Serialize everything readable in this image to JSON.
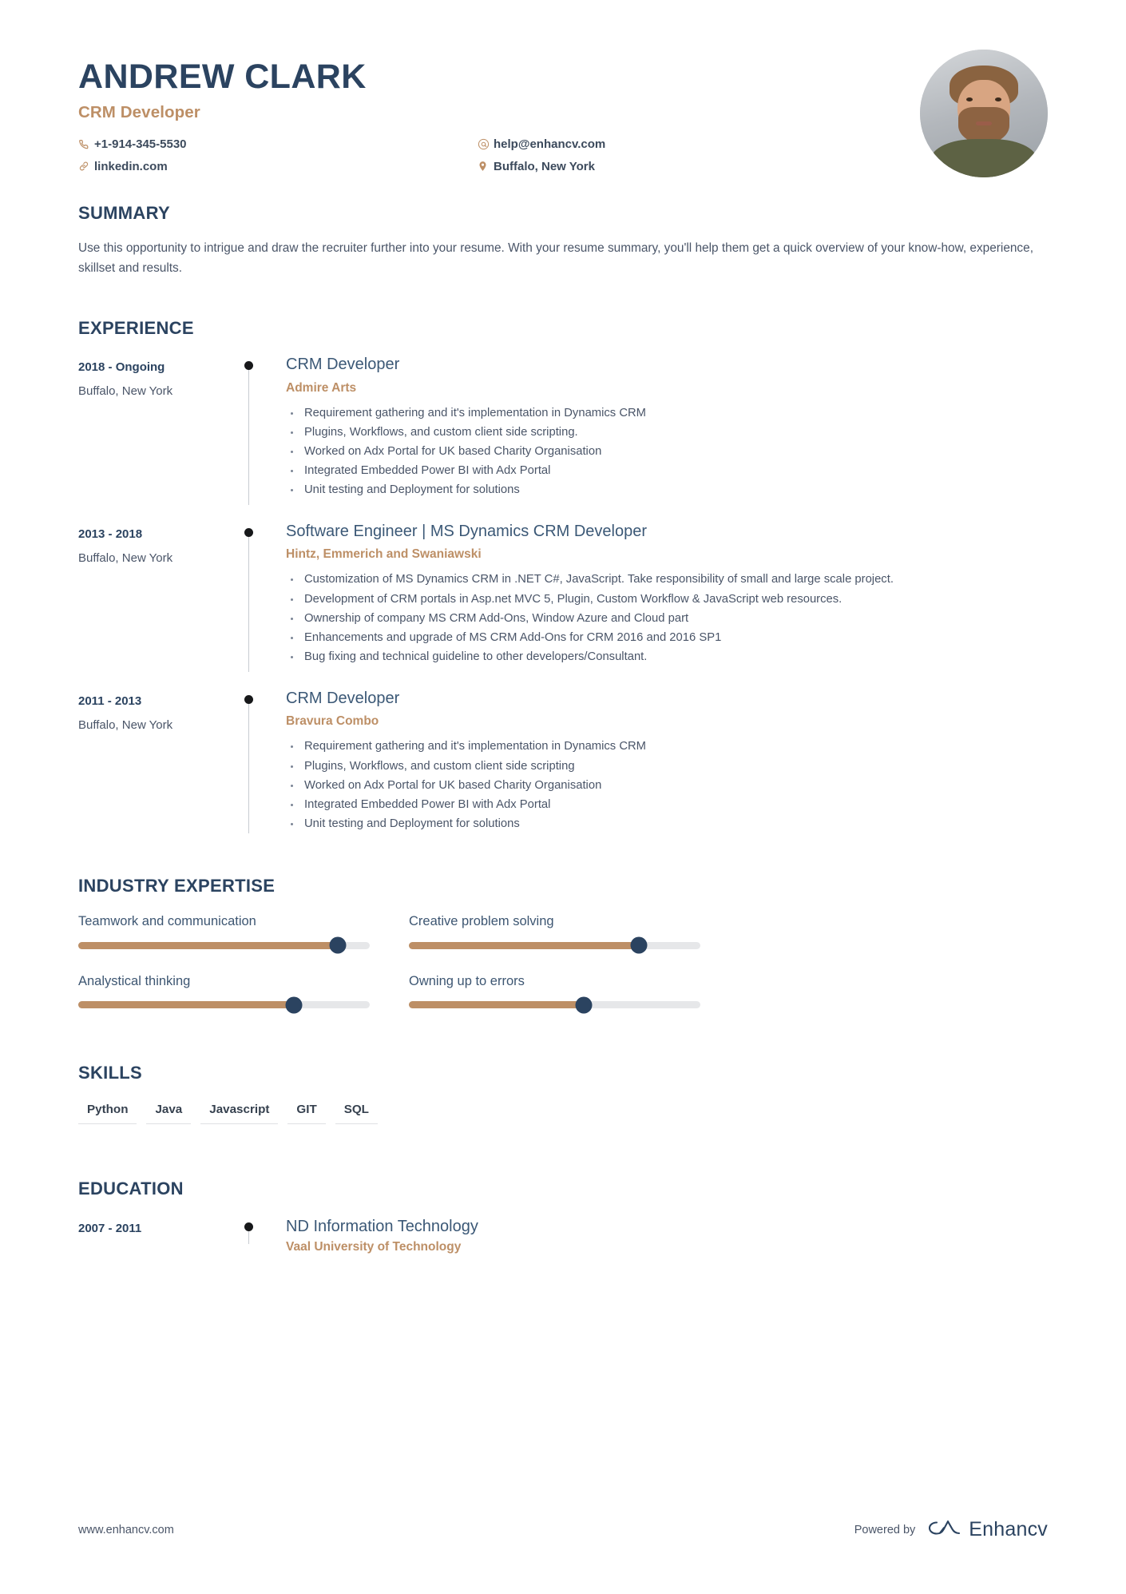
{
  "header": {
    "name": "ANDREW CLARK",
    "role": "CRM Developer",
    "contacts": {
      "phone": "+1-914-345-5530",
      "linkedin": "linkedin.com",
      "email": "help@enhancv.com",
      "location": "Buffalo, New York"
    },
    "photo_alt": "profile-photo"
  },
  "summary": {
    "title": "SUMMARY",
    "text": "Use this opportunity to intrigue and draw the recruiter further into your resume. With your resume summary, you'll help them get a quick overview of your know-how, experience, skillset and results."
  },
  "experience": {
    "title": "EXPERIENCE",
    "items": [
      {
        "date": "2018 - Ongoing",
        "location": "Buffalo, New York",
        "job_title": "CRM Developer",
        "company": "Admire Arts",
        "bullets": [
          "Requirement gathering and it's implementation in Dynamics CRM",
          "Plugins, Workflows, and custom client side scripting.",
          "Worked on Adx Portal for UK based Charity Organisation",
          "Integrated Embedded Power BI with Adx Portal",
          "Unit testing and Deployment for solutions"
        ]
      },
      {
        "date": "2013 - 2018",
        "location": "Buffalo, New York",
        "job_title": "Software Engineer | MS Dynamics CRM Developer",
        "company": "Hintz, Emmerich and Swaniawski",
        "bullets": [
          "Customization of MS Dynamics CRM in .NET C#, JavaScript. Take responsibility of small and large scale project.",
          "Development of CRM portals in Asp.net MVC 5, Plugin, Custom Workflow & JavaScript web resources.",
          "Ownership of company MS CRM Add-Ons, Window Azure and Cloud part",
          "Enhancements and upgrade of MS CRM Add-Ons for CRM 2016 and 2016 SP1",
          "Bug fixing and technical guideline to other developers/Consultant."
        ]
      },
      {
        "date": "2011 - 2013",
        "location": "Buffalo, New York",
        "job_title": "CRM Developer",
        "company": "Bravura Combo",
        "bullets": [
          "Requirement gathering and it's implementation in Dynamics CRM",
          "Plugins, Workflows, and custom client side scripting",
          "Worked on Adx Portal for UK based Charity Organisation",
          "Integrated Embedded Power BI with Adx Portal",
          "Unit testing and Deployment for solutions"
        ]
      }
    ]
  },
  "industry_expertise": {
    "title": "INDUSTRY EXPERTISE",
    "items": [
      {
        "label": "Teamwork and communication",
        "value": 89
      },
      {
        "label": "Creative problem solving",
        "value": 79
      },
      {
        "label": "Analystical thinking",
        "value": 74
      },
      {
        "label": "Owning up to errors",
        "value": 60
      }
    ]
  },
  "skills": {
    "title": "SKILLS",
    "items": [
      "Python",
      "Java",
      "Javascript",
      "GIT",
      "SQL"
    ]
  },
  "education": {
    "title": "EDUCATION",
    "items": [
      {
        "date": "2007 - 2011",
        "degree": "ND Information Technology",
        "school": "Vaal University of Technology"
      }
    ]
  },
  "footer": {
    "url": "www.enhancv.com",
    "powered_by": "Powered by",
    "brand": "Enhancv"
  },
  "colors": {
    "navy": "#2b4360",
    "tan": "#bd8f66",
    "body_text": "#4a5568",
    "track": "#e6e7e9"
  }
}
